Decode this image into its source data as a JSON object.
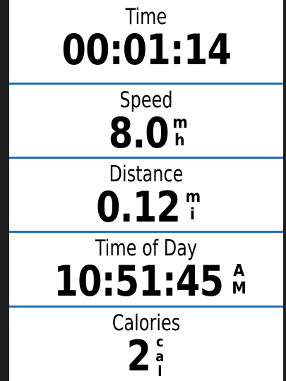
{
  "fields": [
    {
      "label": "Time",
      "value": "00:01:14",
      "unit_top": "",
      "unit_bottom": "",
      "unit_third": ""
    },
    {
      "label": "Speed",
      "value": "8.0",
      "unit_top": "m",
      "unit_bottom": "h",
      "unit_third": ""
    },
    {
      "label": "Distance",
      "value": "0.12",
      "unit_top": "m",
      "unit_bottom": "i",
      "unit_third": ""
    },
    {
      "label": "Time of Day",
      "value": "10:51:45",
      "unit_top": "A",
      "unit_bottom": "M",
      "unit_third": ""
    },
    {
      "label": "Calories",
      "value": "2",
      "unit_top": "c",
      "unit_bottom": "a",
      "unit_third": "l"
    }
  ],
  "colors": {
    "divider": "#1f6fb5",
    "frame": "#1e1e1e",
    "background": "#ffffff",
    "text": "#000000"
  }
}
